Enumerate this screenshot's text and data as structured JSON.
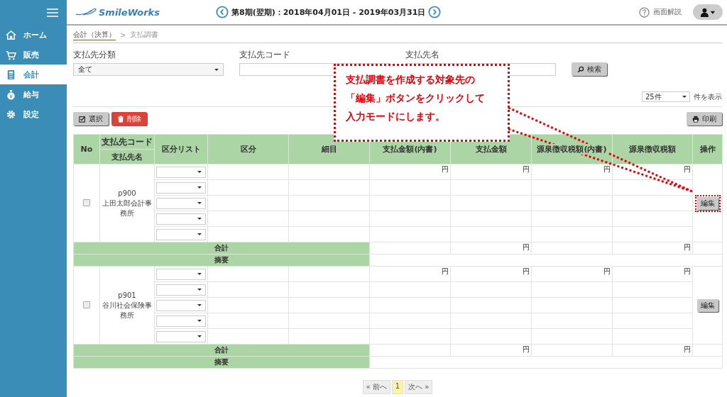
{
  "header": {
    "logo": "SmileWorks",
    "period": "第8期(翌期)：2018年04月01日 - 2019年03月31日",
    "help": "画面解説"
  },
  "sidebar": {
    "items": [
      {
        "label": "ホーム",
        "selected": false
      },
      {
        "label": "販売",
        "selected": false
      },
      {
        "label": "会計",
        "selected": true
      },
      {
        "label": "給与",
        "selected": false
      },
      {
        "label": "設定",
        "selected": false
      }
    ]
  },
  "breadcrumb": {
    "parent": "会計（決算）",
    "separator": ">",
    "current": "支払調書"
  },
  "filters": [
    {
      "label": "支払先分類",
      "kind": "select",
      "value": "全て"
    },
    {
      "label": "支払先コード",
      "kind": "text"
    },
    {
      "label": "支払先名",
      "kind": "text"
    }
  ],
  "search_button": "検索",
  "page_size": {
    "value": "25件",
    "suffix": "件を表示"
  },
  "select_button": "選択",
  "delete_button": "削除",
  "print_button": "印刷",
  "table": {
    "columns": {
      "no": "No",
      "code": "支払先コード",
      "name": "支払先名",
      "category_list": "区分リスト",
      "category": "区分",
      "detail": "細目",
      "payment_breakdown": "支払金額(内書)",
      "payment": "支払金額",
      "tax_breakdown": "源泉徴収税額(内書)",
      "tax": "源泉徴収税額",
      "action": "操作"
    },
    "groups": [
      {
        "checked": false,
        "code": "p900",
        "name": "上田太郎会計事務所",
        "units": [
          "円",
          "円",
          "円",
          "円"
        ],
        "total": {
          "label": "合計",
          "payment": "円",
          "tax": "円"
        },
        "remarks_label": "摘要",
        "edit_button": "編集",
        "highlighted": true
      },
      {
        "checked": false,
        "code": "p901",
        "name": "谷川社会保険事務所",
        "units": [
          "円",
          "円",
          "円",
          "円"
        ],
        "total": {
          "label": "合計",
          "payment": "円",
          "tax": "円"
        },
        "remarks_label": "摘要",
        "edit_button": "編集",
        "highlighted": false
      }
    ]
  },
  "pagination": {
    "prev": "« 前へ",
    "pages": [
      {
        "label": "1",
        "selected": true
      }
    ],
    "next": "次へ »"
  },
  "callout": {
    "text": "支払調書を作成する対象先の「編集」ボタンをクリックして入力モードにします。"
  }
}
